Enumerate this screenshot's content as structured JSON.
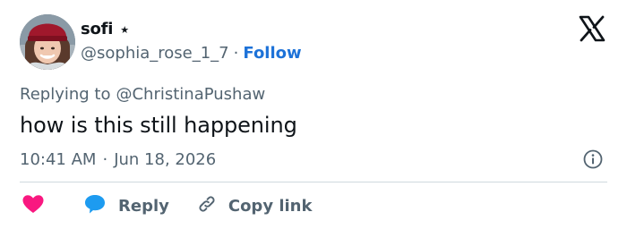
{
  "author": {
    "name": "sofi",
    "badge_icon": "star-icon",
    "handle": "@sophia_rose_1_7",
    "separator": "·",
    "follow_label": "Follow"
  },
  "brand_icon": "x-logo-icon",
  "reply_context": {
    "prefix": "Replying to",
    "target": "@ChristinaPushaw"
  },
  "tweet": {
    "text": "how is this still happening",
    "time": "10:41 AM",
    "separator": "·",
    "date": "Jun 18, 2026"
  },
  "actions": {
    "like_icon": "heart-icon",
    "reply_icon": "speech-bubble-icon",
    "reply_label": "Reply",
    "copy_icon": "link-icon",
    "copy_label": "Copy link"
  },
  "info_icon": "info-icon",
  "colors": {
    "text_primary": "#0f1419",
    "text_secondary": "#536471",
    "link_blue": "#1d72d8",
    "heart_red": "#f91880",
    "reply_blue": "#1d9bf0",
    "divider": "#cfd9de"
  }
}
